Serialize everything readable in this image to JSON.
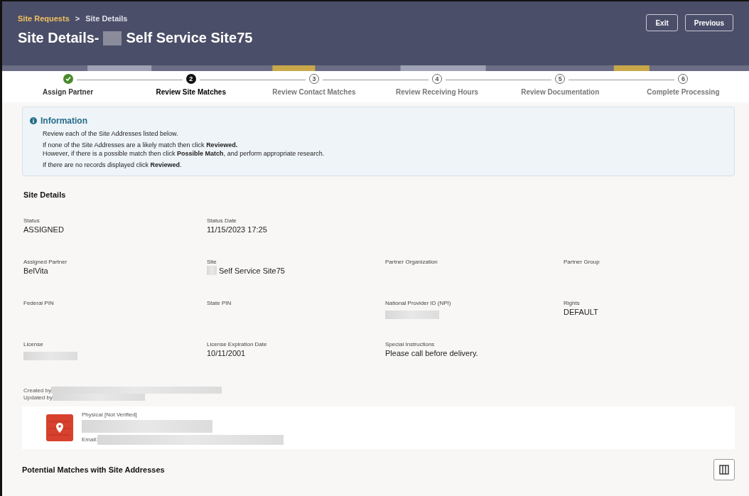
{
  "header": {
    "breadcrumbs": [
      {
        "label": "Site Requests",
        "link": true
      },
      {
        "label": "Site Details",
        "link": false
      }
    ],
    "separator": ">",
    "title": "Site Details-",
    "title_redacted": true,
    "title_rest": "Self Service Site75",
    "buttons": [
      "Exit",
      "Previous"
    ]
  },
  "steps": [
    {
      "label": "Assign Partner",
      "completed": true,
      "selected": false
    },
    {
      "label": "Review Site Matches",
      "completed": false,
      "selected": true,
      "number": "2"
    },
    {
      "label": "Review Contact Matches",
      "completed": false,
      "selected": false,
      "number": "3"
    },
    {
      "label": "Review Receiving Hours",
      "completed": false,
      "selected": false,
      "number": "4"
    },
    {
      "label": "Review Documentation",
      "completed": false,
      "selected": false,
      "number": "5"
    },
    {
      "label": "Complete Processing",
      "completed": false,
      "selected": false,
      "number": "6"
    }
  ],
  "info": {
    "title": "Information",
    "paragraphs": [
      [
        "Review each of the Site Addresses listed below."
      ],
      [
        "If none of the Site Addresses are a likely match then click **Reviewed.**",
        "However, if there is a possible match then click **Possible Match**, and perform appropriate research."
      ],
      [
        "If there are no records displayed click **Reviewed**."
      ]
    ]
  },
  "site_details": {
    "title": "Site Details",
    "rows": [
      [
        {
          "label": "Status",
          "value": "ASSIGNED"
        },
        {
          "label": "Status Date",
          "value": "11/15/2023 17:25"
        }
      ],
      [
        {
          "label": "Assigned Partner",
          "value": "BelVita"
        },
        {
          "label": "Site",
          "value": "Self Service Site75",
          "redacted": true
        },
        {
          "label": "Partner Organization"
        },
        {
          "label": "Partner Group"
        }
      ],
      [
        {
          "label": "Federal PIN"
        },
        {
          "label": "State PIN"
        },
        {
          "label": "National Provider ID (NPI)",
          "redacted": true
        },
        {
          "label": "Rights",
          "value": "DEFAULT"
        }
      ],
      [
        {
          "label": "License",
          "redacted": true
        },
        {
          "label": "License Expiration Date",
          "value": "10/11/2001"
        },
        {
          "label": "Special Instructions",
          "value": "Please call before delivery."
        }
      ]
    ],
    "audit": [
      "Created by",
      "Updated by"
    ]
  },
  "address": {
    "type": "Physical [Not Verified]",
    "email_label": "Email:"
  },
  "matches": {
    "title": "Potential Matches with Site Addresses"
  }
}
